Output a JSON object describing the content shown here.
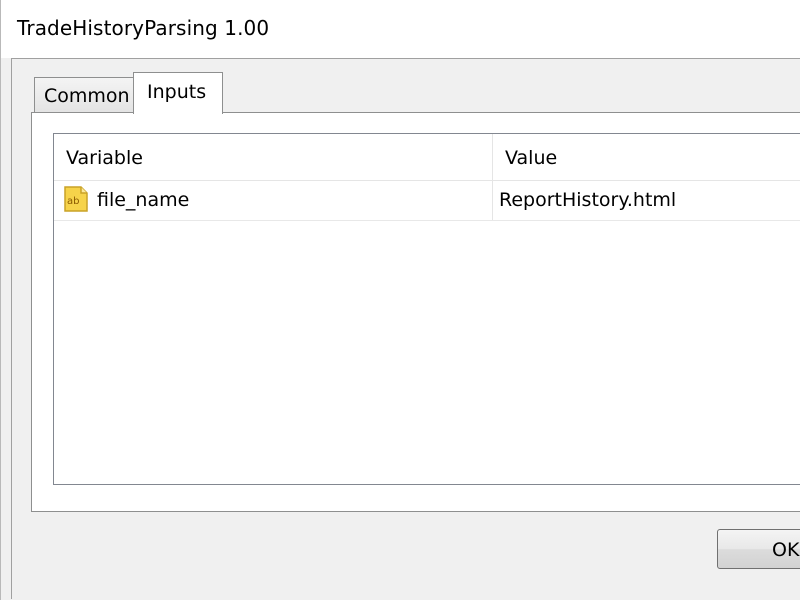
{
  "window": {
    "title": "TradeHistoryParsing 1.00"
  },
  "tabs": [
    {
      "label": "Common",
      "selected": false
    },
    {
      "label": "Inputs",
      "selected": true
    }
  ],
  "inputs_table": {
    "columns": [
      "Variable",
      "Value"
    ],
    "rows": [
      {
        "icon": "ab-string-icon",
        "variable": "file_name",
        "value": "ReportHistory.html"
      }
    ]
  },
  "buttons": {
    "ok_label": "OK"
  },
  "colors": {
    "icon_fill": "#f6d34a",
    "icon_border": "#c9a227",
    "icon_text": "#8a5a00"
  }
}
